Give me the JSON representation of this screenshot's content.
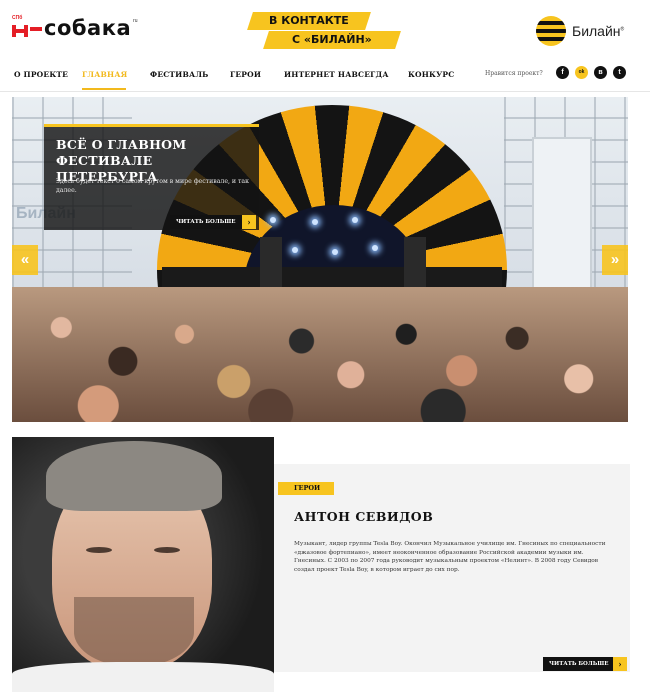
{
  "header": {
    "logo": {
      "small": "СПб",
      "text": "собака",
      "sup": "ru"
    },
    "promo": {
      "line1": "В КОНТАКТЕ",
      "line2": "С «БИЛАЙН»"
    },
    "brand": {
      "text": "Билайн",
      "sup": "®"
    }
  },
  "nav": {
    "items": [
      {
        "label": "О ПРОЕКТЕ",
        "active": false
      },
      {
        "label": "ГЛАВНАЯ",
        "active": true
      },
      {
        "label": "ФЕСТИВАЛЬ",
        "active": false
      },
      {
        "label": "ГЕРОИ",
        "active": false
      },
      {
        "label": "ИНТЕРНЕТ НАВСЕГДА",
        "active": false
      },
      {
        "label": "КОНКУРС",
        "active": false
      }
    ],
    "like_label": "Нравится проект?",
    "social": [
      {
        "icon": "facebook-icon",
        "glyph": "f"
      },
      {
        "icon": "odnoklassniki-icon",
        "glyph": "ok"
      },
      {
        "icon": "vk-icon",
        "glyph": "в"
      },
      {
        "icon": "twitter-icon",
        "glyph": "t"
      }
    ]
  },
  "hero": {
    "title": "ВСЁ О ГЛАВНОМ ФЕСТИВАЛЕ ПЕТЕРБУРГА",
    "text": "Здесь будет текст о самом крутом в мире фестивале, и так далее.",
    "button": "ЧИТАТЬ БОЛЬШЕ",
    "prev_arrow": "«",
    "next_arrow": "»",
    "watermark": "Билайн"
  },
  "hero_card": {
    "tag": "ГЕРОИ",
    "name": "АНТОН СЕВИДОВ",
    "text": "Музыкант, лидер группы Tesla Boy. Окончил Музыкальное училище им. Гнесиных по специальности «джазовое фортепиано», имеет неоконченное образование Российской академии музыки им. Гнесиных. С 2003 по 2007 года руководит музыкальным проектом «Нелинт». В 2008 году Севидов создал проект Tesla Boy, в котором играет до сих пор.",
    "button": "ЧИТАТЬ БОЛЬШЕ"
  },
  "colors": {
    "accent": "#f7c41f",
    "dark": "#111111",
    "card_bg": "#f3f3f3"
  }
}
